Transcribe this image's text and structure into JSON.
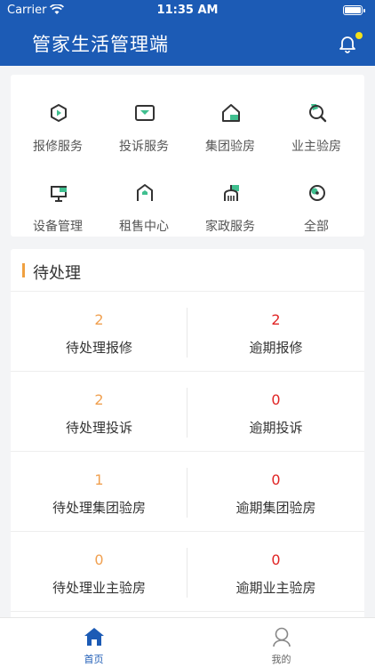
{
  "status_bar": {
    "carrier": "Carrier",
    "time": "11:35 AM"
  },
  "header": {
    "title": "管家生活管理端"
  },
  "menu": [
    {
      "label": "报修服务",
      "icon": "repair-icon"
    },
    {
      "label": "投诉服务",
      "icon": "complaint-icon"
    },
    {
      "label": "集团验房",
      "icon": "group-inspection-icon"
    },
    {
      "label": "业主验房",
      "icon": "owner-inspection-icon"
    },
    {
      "label": "设备管理",
      "icon": "device-icon"
    },
    {
      "label": "租售中心",
      "icon": "rental-icon"
    },
    {
      "label": "家政服务",
      "icon": "housekeeping-icon"
    },
    {
      "label": "全部",
      "icon": "all-icon"
    }
  ],
  "pending": {
    "title": "待处理",
    "rows": [
      {
        "left": {
          "value": "2",
          "label": "待处理报修"
        },
        "right": {
          "value": "2",
          "label": "逾期报修"
        }
      },
      {
        "left": {
          "value": "2",
          "label": "待处理投诉"
        },
        "right": {
          "value": "0",
          "label": "逾期投诉"
        }
      },
      {
        "left": {
          "value": "1",
          "label": "待处理集团验房"
        },
        "right": {
          "value": "0",
          "label": "逾期集团验房"
        }
      },
      {
        "left": {
          "value": "0",
          "label": "待处理业主验房"
        },
        "right": {
          "value": "0",
          "label": "逾期业主验房"
        }
      }
    ]
  },
  "tabbar": {
    "home": "首页",
    "mine": "我的"
  },
  "colors": {
    "primary": "#1c5bb5",
    "accent_orange": "#f0a050",
    "alert_red": "#e02424",
    "badge_yellow": "#f3e11a",
    "icon_green": "#3fbf8f"
  }
}
